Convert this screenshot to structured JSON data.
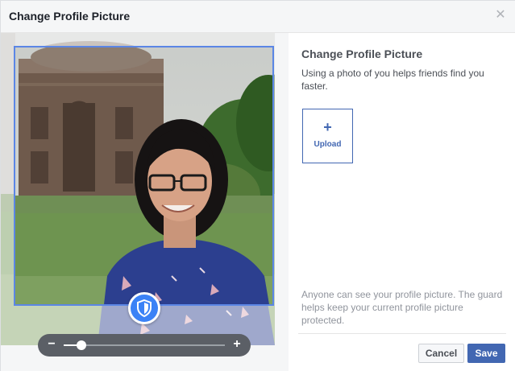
{
  "dialog": {
    "title": "Change Profile Picture",
    "close_icon": "close-icon"
  },
  "photo": {
    "guard_icon": "shield-icon",
    "zoom": {
      "minus_label": "−",
      "plus_label": "+",
      "level_fraction": 0.11
    }
  },
  "side": {
    "title": "Change Profile Picture",
    "description": "Using a photo of you helps friends find you faster.",
    "upload_plus": "+",
    "upload_label": "Upload",
    "note": "Anyone can see your profile picture. The guard helps keep your current profile picture protected."
  },
  "footer": {
    "cancel_label": "Cancel",
    "save_label": "Save"
  },
  "colors": {
    "accent": "#4267b2",
    "guard": "#3b82f6",
    "crop_border": "#5b86e5"
  }
}
